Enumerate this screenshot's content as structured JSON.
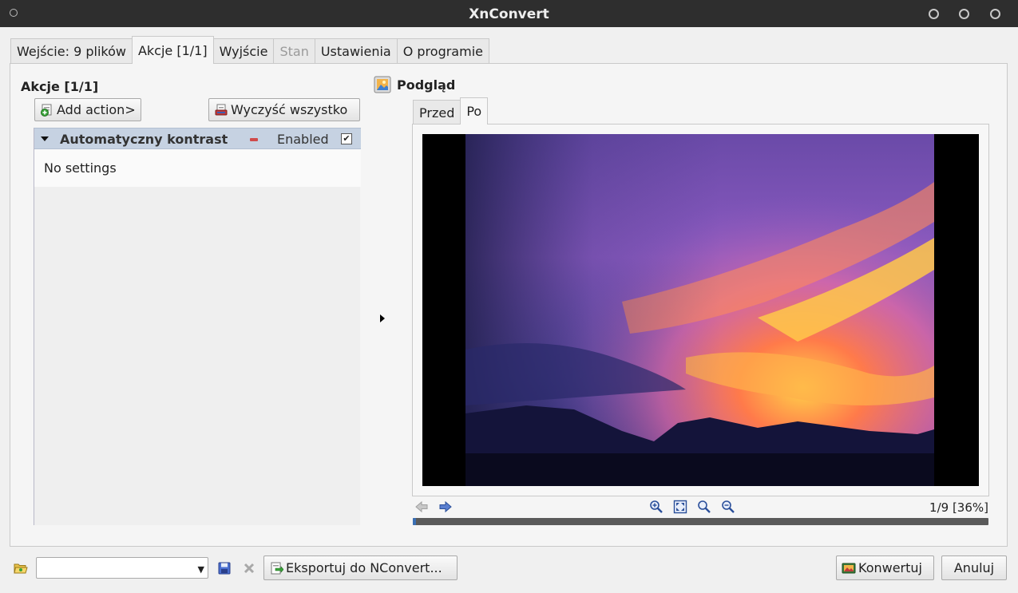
{
  "window": {
    "title": "XnConvert"
  },
  "tabs": [
    {
      "label": "Wejście: 9 plików",
      "state": "normal"
    },
    {
      "label": "Akcje [1/1]",
      "state": "active"
    },
    {
      "label": "Wyjście",
      "state": "normal"
    },
    {
      "label": "Stan",
      "state": "disabled"
    },
    {
      "label": "Ustawienia",
      "state": "normal"
    },
    {
      "label": "O programie",
      "state": "normal"
    }
  ],
  "actions_panel": {
    "title": "Akcje [1/1]",
    "add_button": "Add action>",
    "clear_button": "Wyczyść wszystko",
    "action": {
      "name": "Automatyczny kontrast",
      "enabled_label": "Enabled",
      "enabled": true,
      "settings_text": "No settings"
    }
  },
  "preview": {
    "title": "Podgląd",
    "tabs": [
      {
        "label": "Przed",
        "active": false
      },
      {
        "label": "Po",
        "active": true
      }
    ],
    "counter": "1/9 [36%]",
    "progress": 0.005
  },
  "footer": {
    "export_button": "Eksportuj do NConvert...",
    "convert_button": "Konwertuj",
    "cancel_button": "Anuluj",
    "preset_value": ""
  },
  "colors": {
    "titlebar": "#2e2e2e",
    "action_header": "#c6d2e2",
    "progress_fill": "#3a6fb4"
  },
  "icons": {
    "titlebar_menu": "window-menu-icon",
    "add": "add-icon",
    "clear": "clear-all-icon",
    "preview": "preview-icon",
    "prev": "arrow-left-icon",
    "next": "arrow-right-icon",
    "zoom_in": "zoom-in-icon",
    "fit": "fit-window-icon",
    "zoom_actual": "zoom-actual-icon",
    "zoom_out": "zoom-out-icon",
    "open": "folder-open-icon",
    "save": "save-icon",
    "delete": "delete-icon",
    "export": "export-icon",
    "convert": "convert-icon"
  }
}
